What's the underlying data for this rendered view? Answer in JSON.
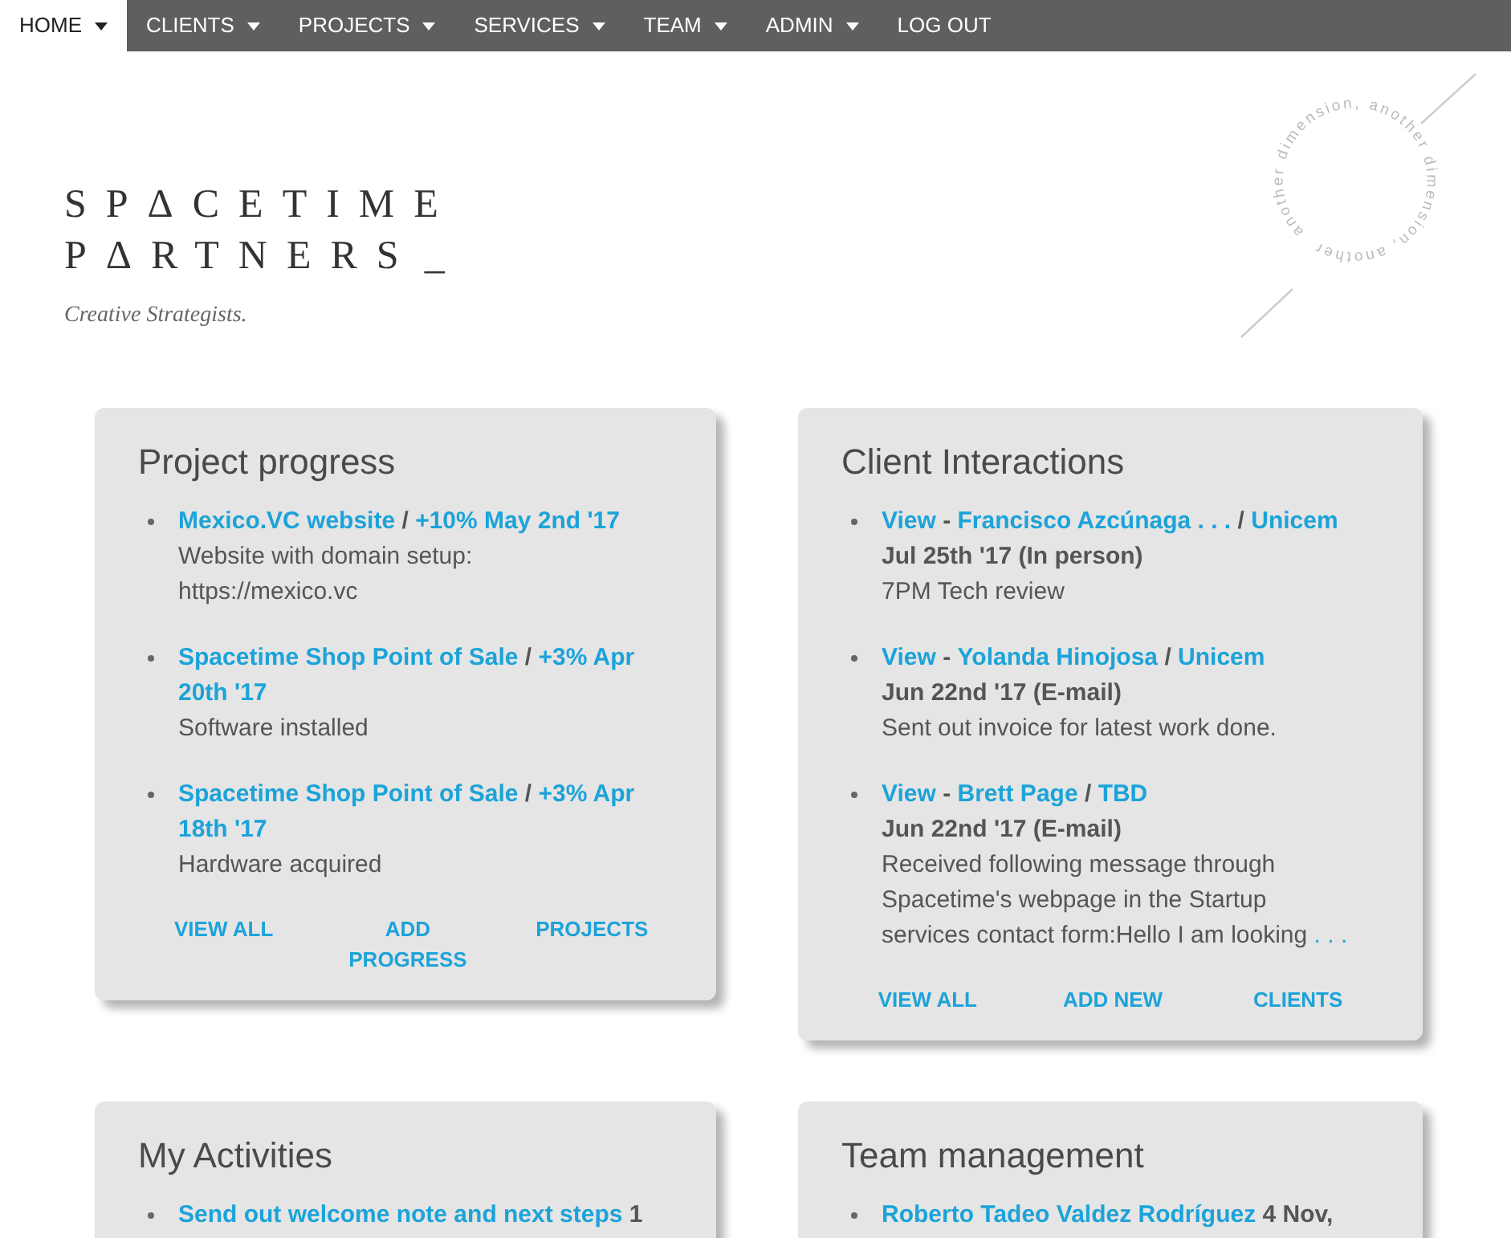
{
  "nav": [
    {
      "label": "HOME",
      "dropdown": true,
      "selected": true
    },
    {
      "label": "CLIENTS",
      "dropdown": true,
      "selected": false
    },
    {
      "label": "PROJECTS",
      "dropdown": true,
      "selected": false
    },
    {
      "label": "SERVICES",
      "dropdown": true,
      "selected": false
    },
    {
      "label": "TEAM",
      "dropdown": true,
      "selected": false
    },
    {
      "label": "ADMIN",
      "dropdown": true,
      "selected": false
    },
    {
      "label": "LOG OUT",
      "dropdown": false,
      "selected": false
    }
  ],
  "logo": {
    "line1": "SPΔCETIME",
    "line2": "PΔRTNERS",
    "cursor": "_",
    "tagline": "Creative Strategists."
  },
  "emblem": {
    "text": "another dimension, another dimension, another"
  },
  "cards": [
    {
      "title": "Project progress",
      "items": [
        {
          "head": [
            {
              "kind": "link",
              "text": "Mexico.VC website"
            },
            {
              "kind": "plain",
              "text": "/"
            },
            {
              "kind": "link",
              "text": "+10% May 2nd '17"
            }
          ],
          "desc": "Website with domain setup: https://mexico.vc"
        },
        {
          "head": [
            {
              "kind": "link",
              "text": "Spacetime Shop Point of Sale"
            },
            {
              "kind": "plain",
              "text": "/"
            },
            {
              "kind": "link",
              "text": "+3% Apr 20th '17"
            }
          ],
          "desc": "Software installed"
        },
        {
          "head": [
            {
              "kind": "link",
              "text": "Spacetime Shop Point of Sale"
            },
            {
              "kind": "plain",
              "text": "/"
            },
            {
              "kind": "link",
              "text": "+3% Apr 18th '17"
            }
          ],
          "desc": "Hardware acquired"
        }
      ],
      "actions": [
        "VIEW ALL",
        "ADD PROGRESS",
        "PROJECTS"
      ]
    },
    {
      "title": "Client Interactions",
      "items": [
        {
          "head": [
            {
              "kind": "link",
              "text": "View"
            },
            {
              "kind": "plain",
              "text": "-"
            },
            {
              "kind": "link",
              "text": "Francisco Azcúnaga . . ."
            },
            {
              "kind": "plain",
              "text": "/"
            },
            {
              "kind": "link",
              "text": "Unicem"
            }
          ],
          "subtitle": "Jul 25th '17 (In person)",
          "desc": "7PM Tech review"
        },
        {
          "head": [
            {
              "kind": "link",
              "text": "View"
            },
            {
              "kind": "plain",
              "text": "-"
            },
            {
              "kind": "link",
              "text": "Yolanda Hinojosa"
            },
            {
              "kind": "plain",
              "text": "/"
            },
            {
              "kind": "link",
              "text": "Unicem"
            }
          ],
          "subtitle": "Jun 22nd '17 (E-mail)",
          "desc": "Sent out invoice for latest work done."
        },
        {
          "head": [
            {
              "kind": "link",
              "text": "View"
            },
            {
              "kind": "plain",
              "text": "-"
            },
            {
              "kind": "link",
              "text": "Brett Page"
            },
            {
              "kind": "plain",
              "text": "/"
            },
            {
              "kind": "link",
              "text": "TBD"
            }
          ],
          "subtitle": "Jun 22nd '17 (E-mail)",
          "desc": "Received following message through Spacetime's webpage in the Startup services contact form:Hello I am looking",
          "more": ". . ."
        }
      ],
      "actions": [
        "VIEW ALL",
        "ADD NEW",
        "CLIENTS"
      ]
    },
    {
      "title": "My Activities",
      "items": [
        {
          "head": [
            {
              "kind": "link",
              "text": "Send out welcome note and next steps"
            },
            {
              "kind": "plain",
              "text": "1"
            }
          ]
        }
      ]
    },
    {
      "title": "Team management",
      "items": [
        {
          "head": [
            {
              "kind": "link",
              "text": "Roberto Tadeo Valdez Rodríguez"
            },
            {
              "kind": "plain",
              "text": "4 Nov,"
            }
          ]
        }
      ]
    }
  ]
}
